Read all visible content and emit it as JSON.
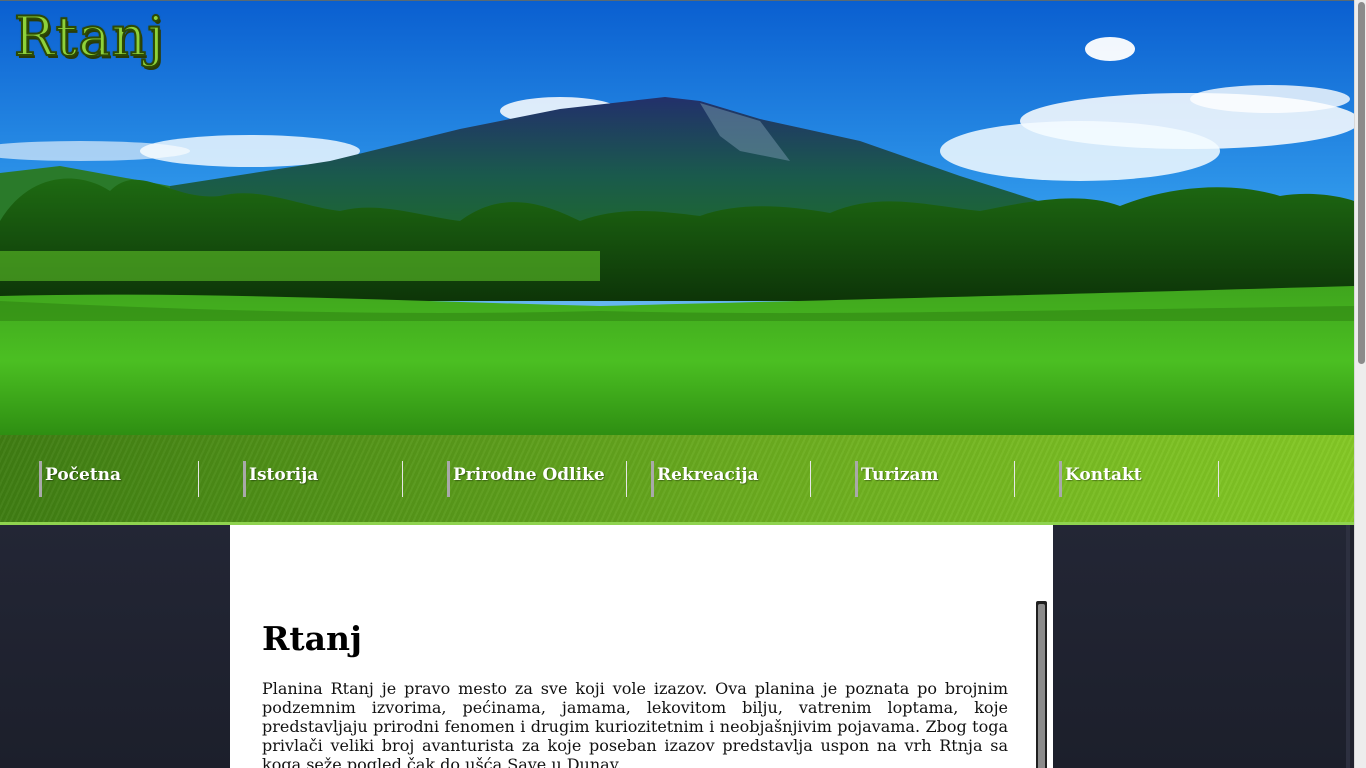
{
  "site": {
    "logo": "Rtanj"
  },
  "nav": {
    "items": [
      {
        "label": "Početna"
      },
      {
        "label": "Istorija"
      },
      {
        "label": "Prirodne Odlike"
      },
      {
        "label": "Rekreacija"
      },
      {
        "label": "Turizam"
      },
      {
        "label": "Kontakt"
      }
    ]
  },
  "content": {
    "title": "Rtanj",
    "paragraph": "Planina Rtanj je pravo mesto za sve koji vole izazov. Ova planina je poznata po brojnim podzemnim izvorima, pećinama, jamama, lekovitom bilju, vatrenim loptama, koje predstavljaju prirodni fenomen i drugim kuriozitetnim i neobjašnjivim pojavama. Zbog toga privlači veliki broj avanturista za koje poseban izazov predstavlja uspon na vrh Rtnja sa koga seže pogled čak do ušća Save u Dunav."
  },
  "colors": {
    "nav_start": "#3f7d13",
    "nav_end": "#84c825",
    "logo": "#8ed23a",
    "side_panels": "#1f222d"
  }
}
